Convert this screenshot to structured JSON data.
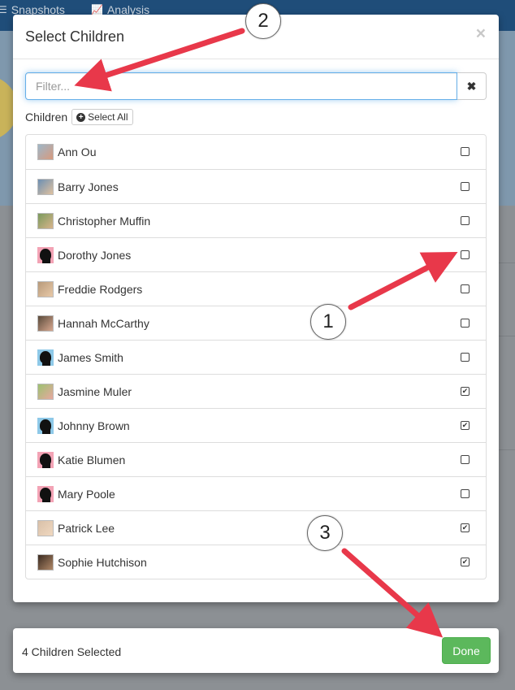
{
  "background": {
    "nav_items": [
      {
        "label": "Snapshots",
        "icon": "list-icon"
      },
      {
        "label": "Analysis",
        "icon": "line-chart-icon"
      }
    ]
  },
  "modal": {
    "title": "Select Children",
    "close_glyph": "×",
    "filter": {
      "placeholder": "Filter...",
      "value": "",
      "clear_glyph": "✖"
    },
    "children_label": "Children",
    "select_all_label": "Select All",
    "children": [
      {
        "name": "Ann Ou",
        "checked": false,
        "avatar": "photo",
        "c1": "#9db7c9",
        "c2": "#d89a7e"
      },
      {
        "name": "Barry Jones",
        "checked": false,
        "avatar": "photo",
        "c1": "#6c8fb3",
        "c2": "#e0c2a0"
      },
      {
        "name": "Christopher Muffin",
        "checked": false,
        "avatar": "photo",
        "c1": "#7a9a5c",
        "c2": "#d8b48c"
      },
      {
        "name": "Dorothy Jones",
        "checked": false,
        "avatar": "silhouette",
        "c1": "#f3a3b5"
      },
      {
        "name": "Freddie Rodgers",
        "checked": false,
        "avatar": "photo",
        "c1": "#b89a7a",
        "c2": "#e8c9a8"
      },
      {
        "name": "Hannah McCarthy",
        "checked": false,
        "avatar": "photo",
        "c1": "#5a4a3a",
        "c2": "#d8a890"
      },
      {
        "name": "James Smith",
        "checked": false,
        "avatar": "silhouette",
        "c1": "#8ec9e8"
      },
      {
        "name": "Jasmine Muler",
        "checked": true,
        "avatar": "photo",
        "c1": "#9cc270",
        "c2": "#e8a8a0"
      },
      {
        "name": "Johnny Brown",
        "checked": true,
        "avatar": "silhouette",
        "c1": "#8ec9e8"
      },
      {
        "name": "Katie Blumen",
        "checked": false,
        "avatar": "silhouette",
        "c1": "#f3a3b5"
      },
      {
        "name": "Mary Poole",
        "checked": false,
        "avatar": "silhouette",
        "c1": "#f3a3b5"
      },
      {
        "name": "Patrick Lee",
        "checked": true,
        "avatar": "photo",
        "c1": "#d8c0a8",
        "c2": "#f0d8c0"
      },
      {
        "name": "Sophie Hutchison",
        "checked": true,
        "avatar": "photo",
        "c1": "#3a2a20",
        "c2": "#b08868"
      }
    ]
  },
  "footer": {
    "selected_text": "4 Children Selected",
    "done_label": "Done"
  },
  "annotations": {
    "callouts": [
      "1",
      "2",
      "3"
    ],
    "arrow_color": "#e8384a"
  },
  "colors": {
    "accent": "#66afe9",
    "done": "#5cb85c",
    "nav": "#1f4d79"
  }
}
